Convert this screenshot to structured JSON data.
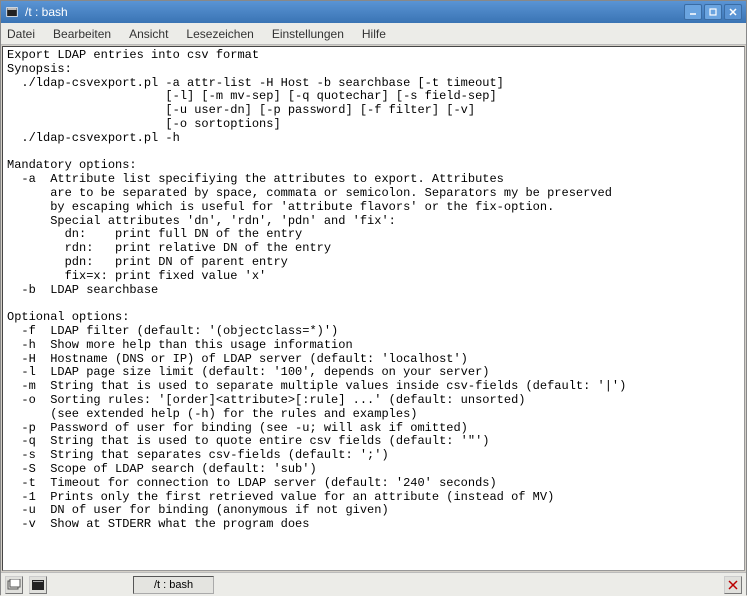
{
  "window": {
    "title": "/t : bash"
  },
  "menubar": {
    "items": [
      "Datei",
      "Bearbeiten",
      "Ansicht",
      "Lesezeichen",
      "Einstellungen",
      "Hilfe"
    ]
  },
  "terminal": {
    "content": "Export LDAP entries into csv format\nSynopsis:\n  ./ldap-csvexport.pl -a attr-list -H Host -b searchbase [-t timeout]\n                      [-l] [-m mv-sep] [-q quotechar] [-s field-sep]\n                      [-u user-dn] [-p password] [-f filter] [-v]\n                      [-o sortoptions]\n  ./ldap-csvexport.pl -h\n\nMandatory options:\n  -a  Attribute list specifiying the attributes to export. Attributes\n      are to be separated by space, commata or semicolon. Separators my be preserved\n      by escaping which is useful for 'attribute flavors' or the fix-option.\n      Special attributes 'dn', 'rdn', 'pdn' and 'fix':\n        dn:    print full DN of the entry\n        rdn:   print relative DN of the entry\n        pdn:   print DN of parent entry\n        fix=x: print fixed value 'x'\n  -b  LDAP searchbase\n\nOptional options:\n  -f  LDAP filter (default: '(objectclass=*)')\n  -h  Show more help than this usage information\n  -H  Hostname (DNS or IP) of LDAP server (default: 'localhost')\n  -l  LDAP page size limit (default: '100', depends on your server)\n  -m  String that is used to separate multiple values inside csv-fields (default: '|')\n  -o  Sorting rules: '[order]<attribute>[:rule] ...' (default: unsorted)\n      (see extended help (-h) for the rules and examples)\n  -p  Password of user for binding (see -u; will ask if omitted)\n  -q  String that is used to quote entire csv fields (default: '\"')\n  -s  String that separates csv-fields (default: ';')\n  -S  Scope of LDAP search (default: 'sub')\n  -t  Timeout for connection to LDAP server (default: '240' seconds)\n  -1  Prints only the first retrieved value for an attribute (instead of MV)\n  -u  DN of user for binding (anonymous if not given)\n  -v  Show at STDERR what the program does"
  },
  "taskbar": {
    "task_label": "/t : bash"
  }
}
